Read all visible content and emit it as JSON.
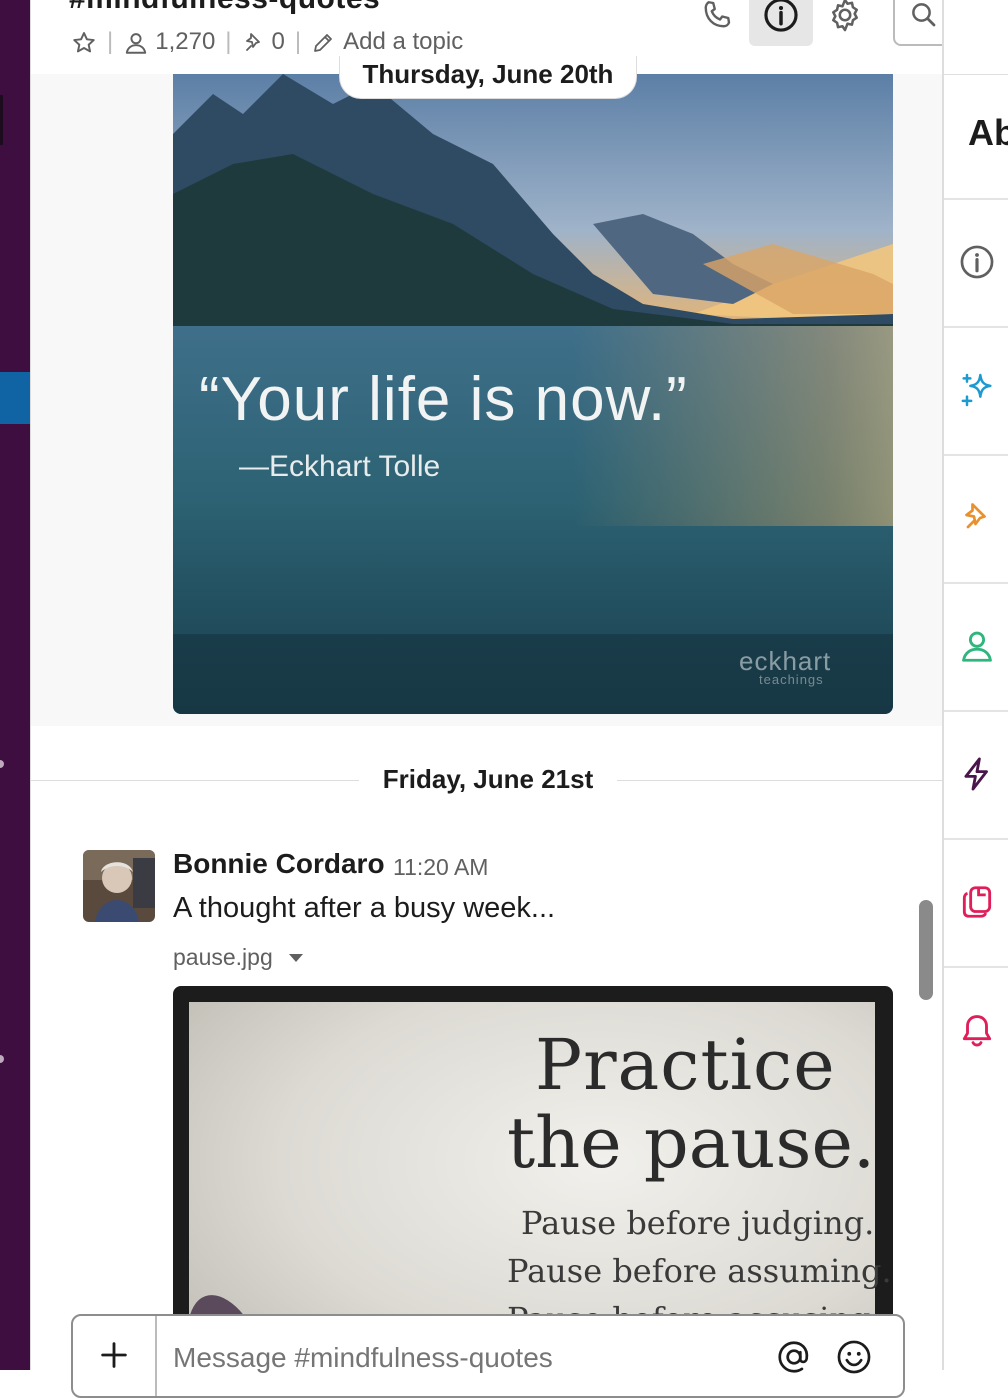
{
  "header": {
    "channel_title": "#mindfulness-quotes",
    "member_count": "1,270",
    "pin_count": "0",
    "topic_placeholder": "Add a topic"
  },
  "feed": {
    "day_1": "Thursday, June 20th",
    "image_1": {
      "quote": "“Your life is now.”",
      "attribution": "—Eckhart Tolle",
      "watermark": "eckhart",
      "watermark_sub": "teachings"
    },
    "day_2": "Friday, June 21st",
    "message": {
      "sender": "Bonnie Cordaro",
      "time": "11:20 AM",
      "text": "A thought after a busy week...",
      "file_name": "pause.jpg",
      "image_2": {
        "title_line1": "Practice",
        "title_line2": "the pause.",
        "line1": "Pause before judging.",
        "line2": "Pause before assuming.",
        "line3": "Pause before accusing."
      }
    }
  },
  "composer": {
    "placeholder": "Message #mindfulness-quotes"
  },
  "right_sidebar": {
    "title": "Ab",
    "icons": [
      "info-icon",
      "sparkle-icon",
      "pin-icon",
      "person-icon",
      "lightning-icon",
      "files-icon",
      "bell-icon"
    ],
    "icon_colors": [
      "#616061",
      "#1d9bd1",
      "#e8912d",
      "#2eb67d",
      "#4a154b",
      "#e01e5a",
      "#e01e5a"
    ]
  },
  "colors": {
    "workspace_bg": "#3f0e40",
    "selected_channel": "#1164a3"
  }
}
